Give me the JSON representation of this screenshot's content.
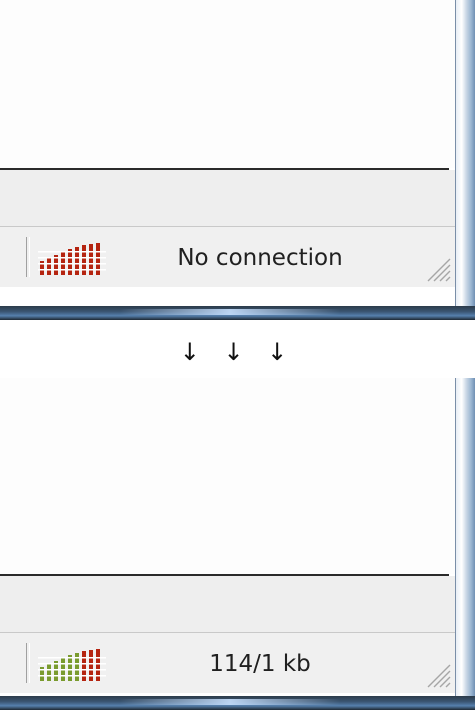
{
  "before": {
    "status_text": "No connection",
    "signal_state": "disconnected",
    "signal_color": "#b52410"
  },
  "transition": {
    "arrows": "↓ ↓ ↓"
  },
  "after": {
    "status_text": "114/1 kb",
    "signal_state": "receiving",
    "signal_colors": [
      "#7a9b2e",
      "#b52410"
    ]
  }
}
